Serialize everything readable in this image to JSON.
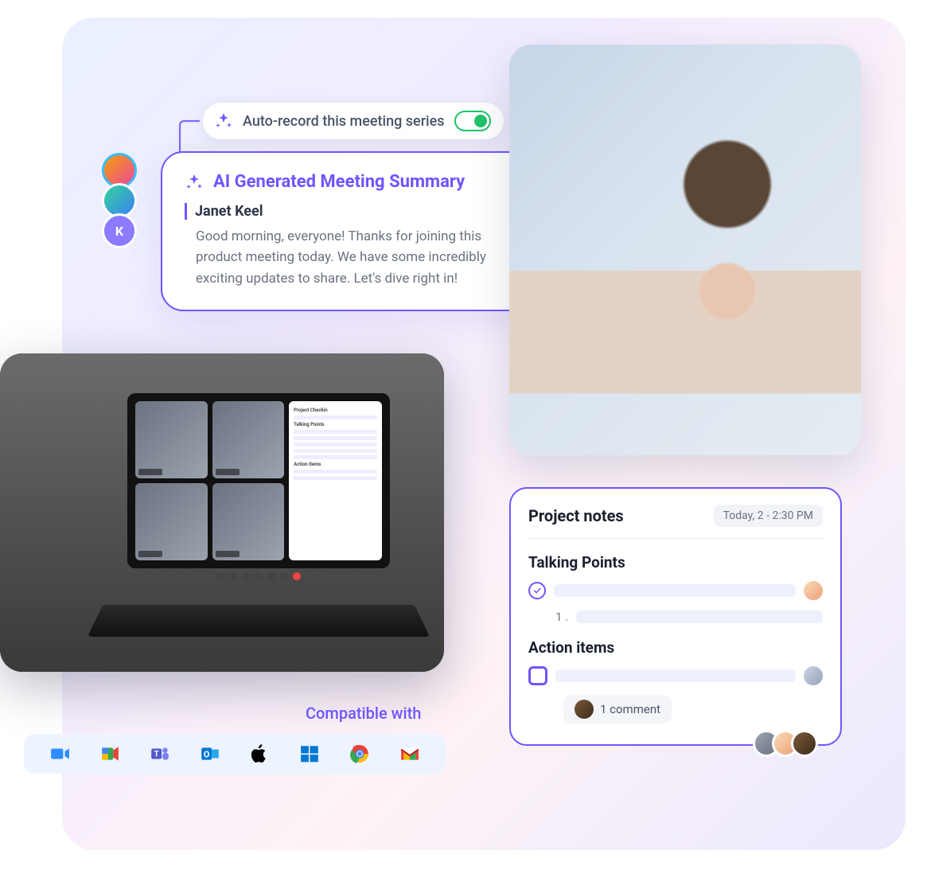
{
  "autorecord": {
    "label": "Auto-record this meeting series",
    "on": true
  },
  "summary": {
    "title": "AI Generated Meeting Summary",
    "speaker": "Janet Keel",
    "body": "Good morning, everyone! Thanks for joining this product meeting today. We have some incredibly exciting updates to share. Let's dive right in!"
  },
  "avatars": {
    "k_letter": "K"
  },
  "laptop_panel": {
    "title": "Project Checkin",
    "talking_points_heading": "Talking Points",
    "action_items_heading": "Action Items"
  },
  "compat": {
    "label": "Compatible with",
    "apps": [
      "zoom",
      "google-meet",
      "microsoft-teams",
      "outlook",
      "apple",
      "windows",
      "chrome",
      "gmail"
    ]
  },
  "notes": {
    "title": "Project notes",
    "time": "Today, 2 - 2:30 PM",
    "talking_points_heading": "Talking Points",
    "action_items_heading": "Action items",
    "sub_number": "1 .",
    "comment": "1 comment"
  }
}
